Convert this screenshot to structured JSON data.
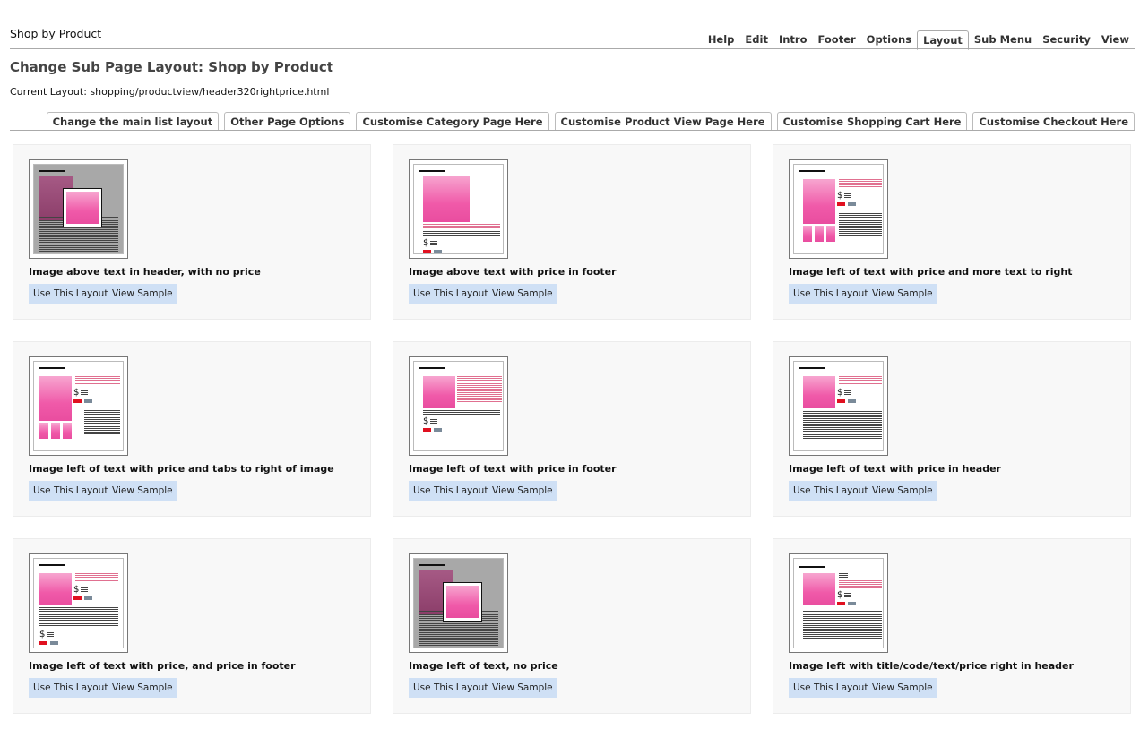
{
  "header": {
    "app_title": "Shop by Product",
    "tabs": [
      {
        "label": "Help",
        "active": false
      },
      {
        "label": "Edit",
        "active": false
      },
      {
        "label": "Intro",
        "active": false
      },
      {
        "label": "Footer",
        "active": false
      },
      {
        "label": "Options",
        "active": false
      },
      {
        "label": "Layout",
        "active": true
      },
      {
        "label": "Sub Menu",
        "active": false
      },
      {
        "label": "Security",
        "active": false
      },
      {
        "label": "View",
        "active": false
      }
    ]
  },
  "page": {
    "title": "Change Sub Page Layout: Shop by Product",
    "current_layout": "Current Layout: shopping/productview/header320rightprice.html"
  },
  "sub_tabs": [
    "Change the main list layout",
    "Other Page Options",
    "Customise Category Page Here",
    "Customise Product View Page Here",
    "Customise Shopping Cart Here",
    "Customise Checkout Here"
  ],
  "buttons": {
    "use": "Use This Layout",
    "view": "View Sample"
  },
  "layouts": [
    {
      "label": "Image above text in header, with no price",
      "thumb": "overlay"
    },
    {
      "label": "Image above text with price in footer",
      "thumb": "above-footer"
    },
    {
      "label": "Image left of text with price and more text to right",
      "thumb": "left-more"
    },
    {
      "label": "Image left of text with price and tabs to right of image",
      "thumb": "left-tabs"
    },
    {
      "label": "Image left of text with price in footer",
      "thumb": "left-footer"
    },
    {
      "label": "Image left of text with price in header",
      "thumb": "left-header"
    },
    {
      "label": "Image left of text with price, and price in footer",
      "thumb": "left-both"
    },
    {
      "label": "Image left of text, no price",
      "thumb": "overlay"
    },
    {
      "label": "Image left with title/code/text/price right in header",
      "thumb": "left-title"
    }
  ],
  "icons": {
    "dollar": "$"
  },
  "colors": {
    "button_bg": "#cfe0f5",
    "card_bg": "#f8f8f8",
    "accent_pink": "#f05aa9",
    "price_red": "#e01020"
  }
}
